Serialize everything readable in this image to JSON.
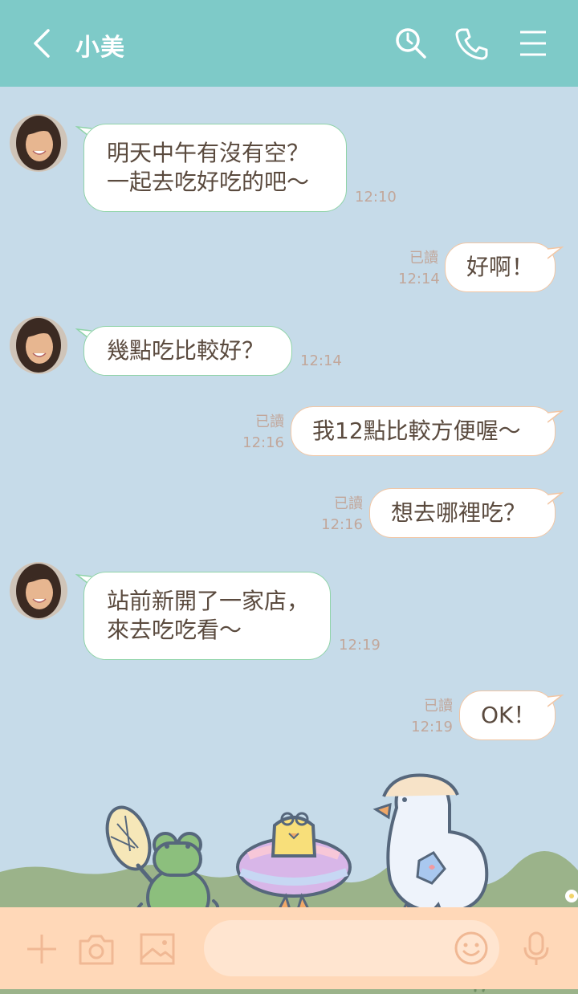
{
  "header": {
    "title": "小美",
    "icons": [
      "back-icon",
      "search-icon",
      "phone-icon",
      "menu-icon"
    ]
  },
  "messages": [
    {
      "from": "contact",
      "lines": [
        "明天中午有沒有空？",
        "一起去吃好吃的吧〜"
      ],
      "time": "12:10"
    },
    {
      "from": "me",
      "text": "好啊！",
      "read": "已讀",
      "time": "12:14"
    },
    {
      "from": "contact",
      "lines": [
        "幾點吃比較好？"
      ],
      "time": "12:14"
    },
    {
      "from": "me",
      "text": "我12點比較方便喔〜",
      "read": "已讀",
      "time": "12:16"
    },
    {
      "from": "me",
      "text": "想去哪裡吃？",
      "read": "已讀",
      "time": "12:16"
    },
    {
      "from": "contact",
      "lines": [
        "站前新開了一家店，",
        "來去吃吃看〜"
      ],
      "time": "12:19"
    },
    {
      "from": "me",
      "text": "OK！",
      "read": "已讀",
      "time": "12:19"
    }
  ],
  "footer": {
    "input_value": "",
    "icons": [
      "plus-icon",
      "camera-icon",
      "image-icon",
      "emoji-icon",
      "mic-icon"
    ]
  },
  "colors": {
    "header_bg": "#7ecac8",
    "chat_bg": "#c6dbe9",
    "footer_bg": "#ffd8b8",
    "text": "#5a4a3e",
    "incoming_border": "#8fd3a8",
    "outgoing_border": "#f2c6a4",
    "timestamp": "#c2a79b",
    "grass": "#9bb38a"
  }
}
